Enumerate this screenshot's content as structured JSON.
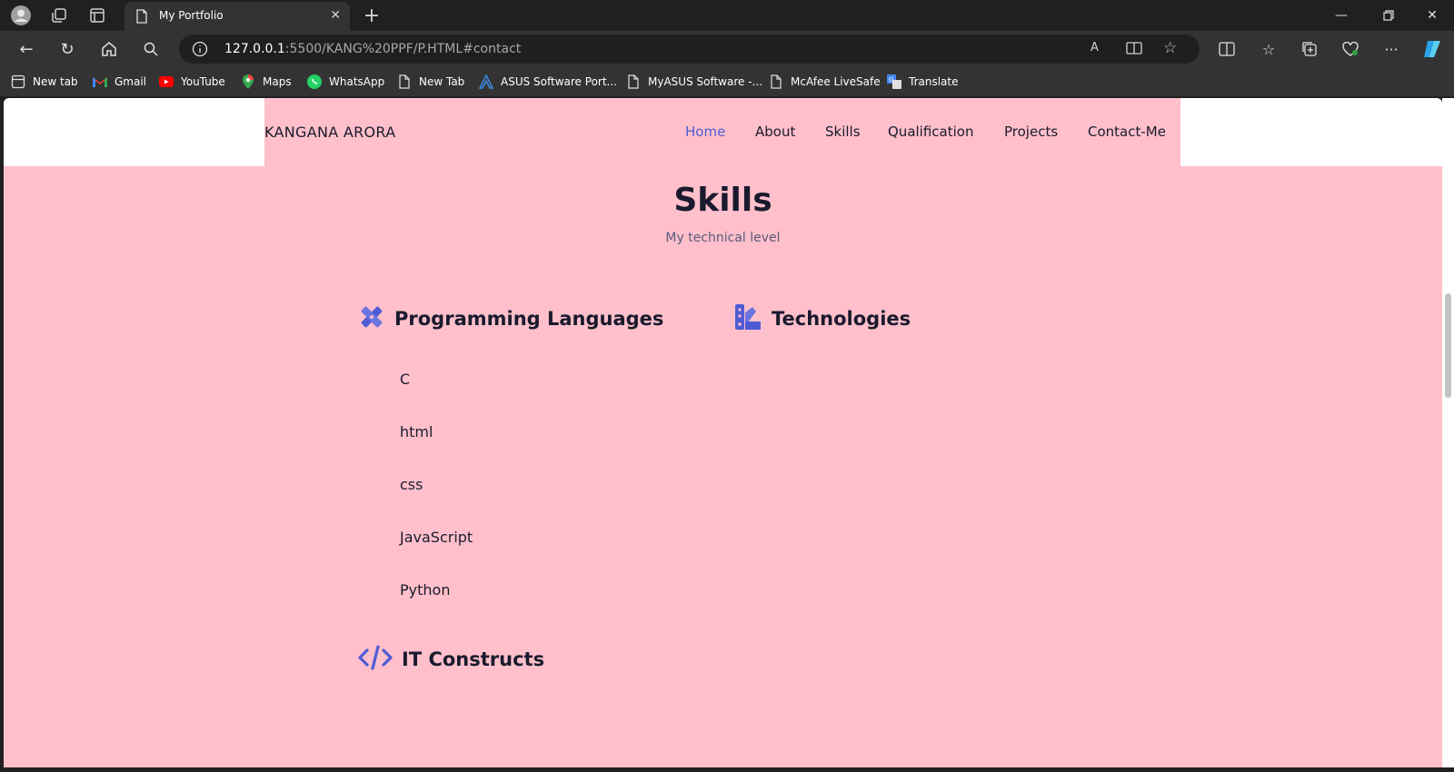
{
  "browser": {
    "tab_title": "My Portfolio",
    "url_host": "127.0.0.1",
    "url_rest": ":5500/KANG%20PPF/P.HTML#contact",
    "bookmarks": [
      "New tab",
      "Gmail",
      "YouTube",
      "Maps",
      "WhatsApp",
      "New Tab",
      "ASUS Software Port...",
      "MyASUS Software -...",
      "McAfee LiveSafe",
      "Translate"
    ]
  },
  "header": {
    "logo": "KANGANA ARORA",
    "nav": [
      "Home",
      "About",
      "Skills",
      "Qualification",
      "Projects",
      "Contact-Me"
    ],
    "active_nav": "Home"
  },
  "skills": {
    "title": "Skills",
    "subtitle": "My technical level",
    "programming": {
      "heading": "Programming Languages",
      "items": [
        "C",
        "html",
        "css",
        "JavaScript",
        "Python"
      ]
    },
    "technologies": {
      "heading": "Technologies"
    },
    "it_constructs": {
      "heading": "IT Constructs"
    }
  },
  "colors": {
    "page_bg": "#ffc0cb",
    "accent": "#4f5bd5",
    "text": "#1a1a2e"
  }
}
